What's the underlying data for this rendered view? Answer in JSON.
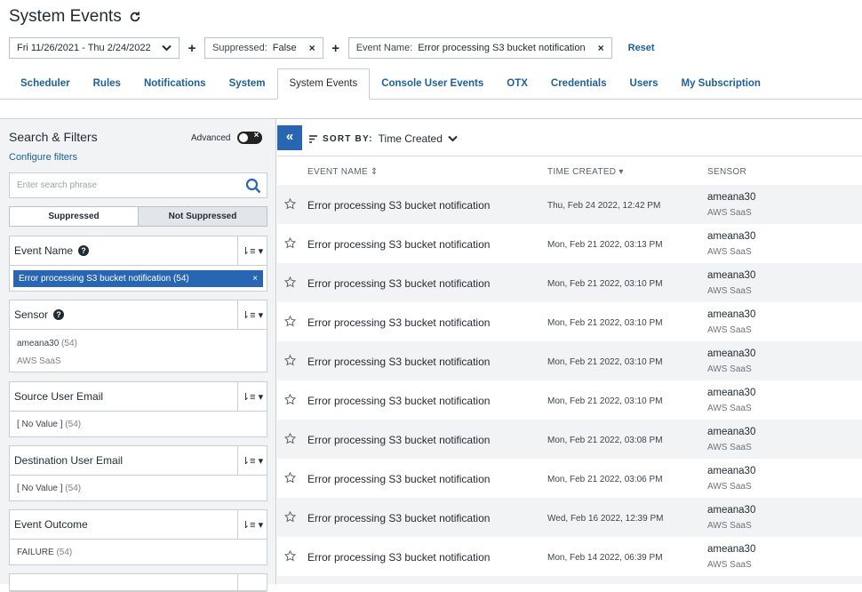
{
  "header": {
    "title": "System Events"
  },
  "filters": {
    "date_range": "Fri 11/26/2021 - Thu 2/24/2022",
    "suppressed": {
      "key": "Suppressed:",
      "value": "False"
    },
    "event_name": {
      "key": "Event Name:",
      "value": "Error processing S3 bucket notification"
    },
    "add_symbol": "+",
    "remove_symbol": "×",
    "reset_label": "Reset"
  },
  "tabs": [
    {
      "label": "Scheduler"
    },
    {
      "label": "Rules"
    },
    {
      "label": "Notifications"
    },
    {
      "label": "System"
    },
    {
      "label": "System Events",
      "active": true
    },
    {
      "label": "Console User Events"
    },
    {
      "label": "OTX"
    },
    {
      "label": "Credentials"
    },
    {
      "label": "Users"
    },
    {
      "label": "My Subscription"
    }
  ],
  "sidebar": {
    "title": "Search & Filters",
    "advanced_label": "Advanced",
    "configure_label": "Configure filters",
    "search_placeholder": "Enter search phrase",
    "segment": {
      "left": "Suppressed",
      "right": "Not Suppressed"
    },
    "event_name": {
      "label": "Event Name",
      "chip": "Error processing S3 bucket notification (54)"
    },
    "sensor": {
      "label": "Sensor",
      "value": "ameana30",
      "count": "(54)",
      "sub": "AWS SaaS"
    },
    "source_email": {
      "label": "Source User Email",
      "value": "[ No Value ]",
      "count": "(54)"
    },
    "dest_email": {
      "label": "Destination User Email",
      "value": "[ No Value ]",
      "count": "(54)"
    },
    "outcome": {
      "label": "Event Outcome",
      "value": "FAILURE",
      "count": "(54)"
    }
  },
  "main": {
    "sort_label": "SORT BY:",
    "sort_value": "Time Created",
    "columns": {
      "name": "EVENT NAME",
      "time": "TIME CREATED",
      "sensor": "SENSOR"
    },
    "rows": [
      {
        "name": "Error processing S3 bucket notification",
        "time": "Thu, Feb 24 2022, 12:42 PM",
        "sensor": "ameana30",
        "sensor_sub": "AWS SaaS"
      },
      {
        "name": "Error processing S3 bucket notification",
        "time": "Mon, Feb 21 2022, 03:13 PM",
        "sensor": "ameana30",
        "sensor_sub": "AWS SaaS"
      },
      {
        "name": "Error processing S3 bucket notification",
        "time": "Mon, Feb 21 2022, 03:10 PM",
        "sensor": "ameana30",
        "sensor_sub": "AWS SaaS"
      },
      {
        "name": "Error processing S3 bucket notification",
        "time": "Mon, Feb 21 2022, 03:10 PM",
        "sensor": "ameana30",
        "sensor_sub": "AWS SaaS"
      },
      {
        "name": "Error processing S3 bucket notification",
        "time": "Mon, Feb 21 2022, 03:10 PM",
        "sensor": "ameana30",
        "sensor_sub": "AWS SaaS"
      },
      {
        "name": "Error processing S3 bucket notification",
        "time": "Mon, Feb 21 2022, 03:10 PM",
        "sensor": "ameana30",
        "sensor_sub": "AWS SaaS"
      },
      {
        "name": "Error processing S3 bucket notification",
        "time": "Mon, Feb 21 2022, 03:08 PM",
        "sensor": "ameana30",
        "sensor_sub": "AWS SaaS"
      },
      {
        "name": "Error processing S3 bucket notification",
        "time": "Mon, Feb 21 2022, 03:06 PM",
        "sensor": "ameana30",
        "sensor_sub": "AWS SaaS"
      },
      {
        "name": "Error processing S3 bucket notification",
        "time": "Wed, Feb 16 2022, 12:39 PM",
        "sensor": "ameana30",
        "sensor_sub": "AWS SaaS"
      },
      {
        "name": "Error processing S3 bucket notification",
        "time": "Mon, Feb 14 2022, 06:39 PM",
        "sensor": "ameana30",
        "sensor_sub": "AWS SaaS"
      }
    ]
  }
}
